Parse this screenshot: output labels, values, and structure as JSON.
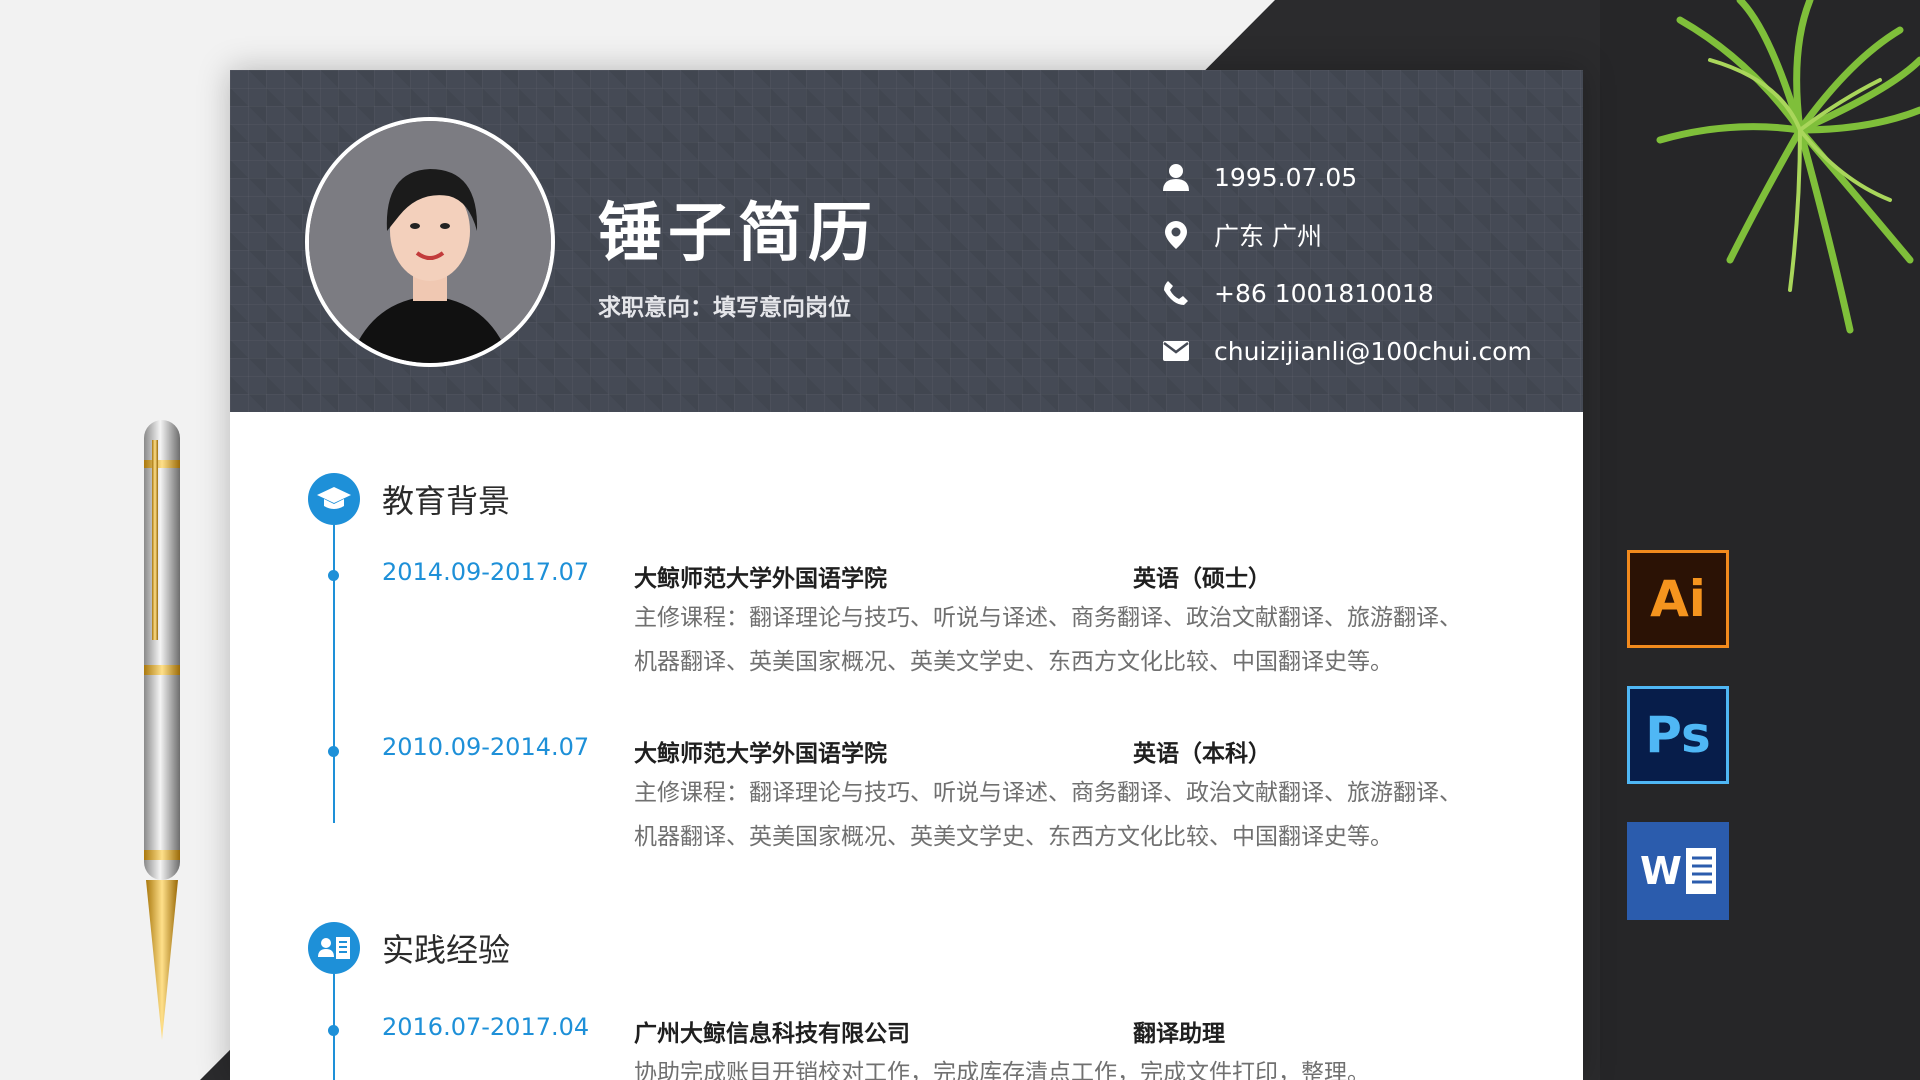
{
  "colors": {
    "accent": "#1e90d8",
    "header_bg": "#454a55",
    "desk": "#2b2b2d"
  },
  "header": {
    "name": "锤子简历",
    "intent": "求职意向：填写意向岗位",
    "contacts": [
      {
        "icon": "person-icon",
        "text": "1995.07.05"
      },
      {
        "icon": "location-icon",
        "text": "广东 广州"
      },
      {
        "icon": "phone-icon",
        "text": "+86 1001810018"
      },
      {
        "icon": "mail-icon",
        "text": "chuizijianli@100chui.com"
      }
    ]
  },
  "education": {
    "title": "教育背景",
    "icon": "graduation-cap-icon",
    "entries": [
      {
        "date": "2014.09-2017.07",
        "school": "大鲸师范大学外国语学院",
        "degree": "英语（硕士）",
        "desc_line1": "主修课程：翻译理论与技巧、听说与译述、商务翻译、政治文献翻译、旅游翻译、",
        "desc_line2": "机器翻译、英美国家概况、英美文学史、东西方文化比较、中国翻译史等。"
      },
      {
        "date": "2010.09-2014.07",
        "school": "大鲸师范大学外国语学院",
        "degree": "英语（本科）",
        "desc_line1": "主修课程：翻译理论与技巧、听说与译述、商务翻译、政治文献翻译、旅游翻译、",
        "desc_line2": "机器翻译、英美国家概况、英美文学史、东西方文化比较、中国翻译史等。"
      }
    ]
  },
  "practice": {
    "title": "实践经验",
    "icon": "profile-card-icon",
    "entries": [
      {
        "date": "2016.07-2017.04",
        "company": "广州大鲸信息科技有限公司",
        "role": "翻译助理",
        "desc_line1": "协助完成账目开销校对工作，完成库存清点工作，完成文件打印，整理。"
      }
    ]
  },
  "software_icons": [
    {
      "label": "Ai",
      "icon": "illustrator-icon"
    },
    {
      "label": "Ps",
      "icon": "photoshop-icon"
    },
    {
      "label": "W",
      "icon": "word-icon"
    }
  ]
}
